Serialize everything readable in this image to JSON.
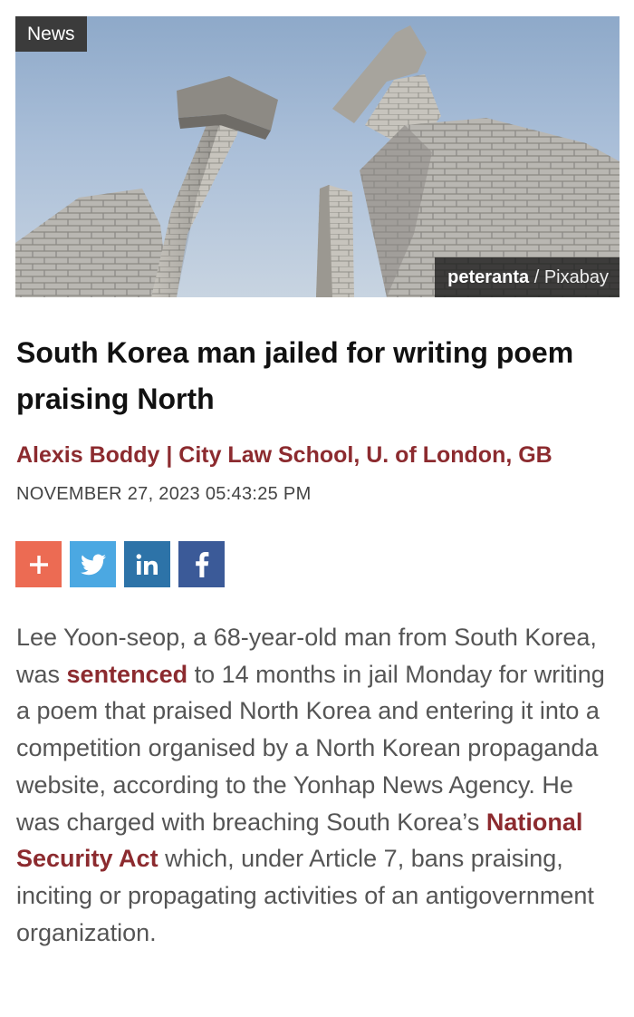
{
  "hero": {
    "badge": "News",
    "credit": {
      "author": "peteranta",
      "separator": " / ",
      "site": "Pixabay"
    }
  },
  "article": {
    "title": "South Korea man jailed for writing poem praising North",
    "byline": "Alexis Boddy | City Law School, U. of London, GB",
    "date": "NOVEMBER 27, 2023 05:43:25 PM"
  },
  "share": [
    {
      "icon": "plus-icon",
      "label": "+",
      "color": "#ec6b53"
    },
    {
      "icon": "twitter-icon",
      "color": "#4ba8e2"
    },
    {
      "icon": "linkedin-icon",
      "label": "in",
      "color": "#2d73a8"
    },
    {
      "icon": "facebook-icon",
      "label": "f",
      "color": "#3b5a98"
    }
  ],
  "body": {
    "part1": "Lee Yoon-seop, a 68-year-old man from South Korea, was ",
    "link1": "sentenced",
    "part2": " to 14 months in jail Monday for writing a poem that praised North Korea and entering it into a competition organised by a North Korean propaganda website, according to the Yonhap News Agency. He was charged with breaching South Korea’s ",
    "link2": "National Security Act",
    "part3": " which, under Article 7, bans praising, inciting or propagating activities of an antigovernment organization."
  },
  "colors": {
    "accent": "#8c2b2f",
    "badge_bg": "#3b3b3b"
  }
}
